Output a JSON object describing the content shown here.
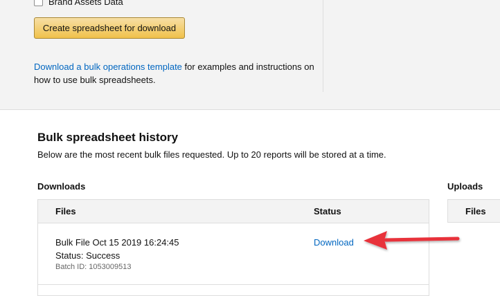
{
  "filters": {
    "brand_assets_label": "Brand Assets Data"
  },
  "actions": {
    "create_button_label": "Create spreadsheet for download"
  },
  "template_info": {
    "link_text": "Download a bulk operations template",
    "rest_text": " for examples and instructions on how to use bulk spreadsheets."
  },
  "history": {
    "title": "Bulk spreadsheet history",
    "description": "Below are the most recent bulk files requested. Up to 20 reports will be stored at a time.",
    "downloads_label": "Downloads",
    "uploads_label": "Uploads",
    "downloads_columns": {
      "files": "Files",
      "status": "Status"
    },
    "uploads_columns": {
      "files": "Files"
    },
    "rows": [
      {
        "file_name": "Bulk File Oct 15 2019 16:24:45",
        "status_text": "Status: Success",
        "batch_id": "Batch ID: 1053009513",
        "action_label": "Download"
      }
    ]
  },
  "colors": {
    "link": "#0066c0",
    "button_top": "#f7dfa5",
    "button_bottom": "#f0c14b",
    "panel_bg": "#f3f3f3",
    "annotation_arrow": "#e8333b"
  }
}
